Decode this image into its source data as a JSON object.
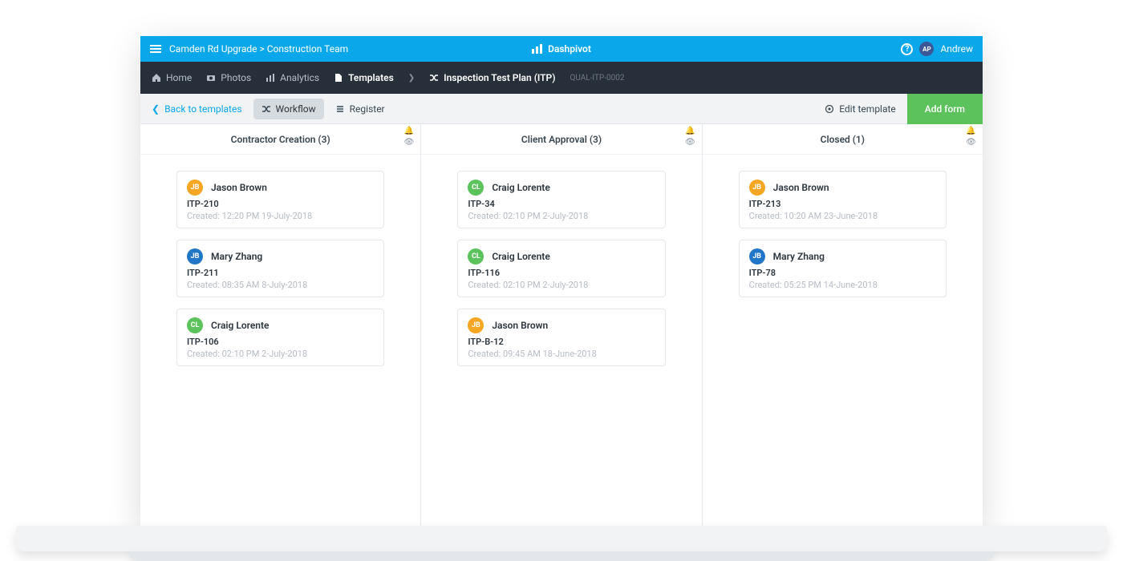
{
  "app": {
    "name": "Dashpivot"
  },
  "header": {
    "breadcrumb": "Camden Rd Upgrade > Construction Team",
    "user": {
      "initials": "AP",
      "name": "Andrew"
    }
  },
  "nav": {
    "home": "Home",
    "photos": "Photos",
    "analytics": "Analytics",
    "templates": "Templates",
    "template_name": "Inspection Test Plan (ITP)",
    "template_code": "QUAL-ITP-0002"
  },
  "toolbar": {
    "back": "Back to templates",
    "workflow": "Workflow",
    "register": "Register",
    "edit": "Edit template",
    "add": "Add form"
  },
  "colors": {
    "jb_orange": "#f5a623",
    "jb_blue": "#2176c7",
    "cl_green": "#5cc25c"
  },
  "columns": [
    {
      "title": "Contractor Creation (3)",
      "cards": [
        {
          "initials": "JB",
          "color": "jb_orange",
          "name": "Jason Brown",
          "ref": "ITP-210",
          "meta": "Created: 12:20 PM 19-July-2018"
        },
        {
          "initials": "JB",
          "color": "jb_blue",
          "name": "Mary Zhang",
          "ref": "ITP-211",
          "meta": "Created: 08:35 AM 8-July-2018"
        },
        {
          "initials": "CL",
          "color": "cl_green",
          "name": "Craig Lorente",
          "ref": "ITP-106",
          "meta": "Created: 02:10 PM 2-July-2018"
        }
      ]
    },
    {
      "title": "Client Approval (3)",
      "cards": [
        {
          "initials": "CL",
          "color": "cl_green",
          "name": "Craig Lorente",
          "ref": "ITP-34",
          "meta": "Created: 02:10 PM 2-July-2018"
        },
        {
          "initials": "CL",
          "color": "cl_green",
          "name": "Craig Lorente",
          "ref": "ITP-116",
          "meta": "Created: 02:10 PM 2-July-2018"
        },
        {
          "initials": "JB",
          "color": "jb_orange",
          "name": "Jason Brown",
          "ref": "ITP-B-12",
          "meta": "Created: 09:45 AM 18-June-2018"
        }
      ]
    },
    {
      "title": "Closed (1)",
      "cards": [
        {
          "initials": "JB",
          "color": "jb_orange",
          "name": "Jason Brown",
          "ref": "ITP-213",
          "meta": "Created: 10:20 AM 23-June-2018"
        },
        {
          "initials": "JB",
          "color": "jb_blue",
          "name": "Mary Zhang",
          "ref": "ITP-78",
          "meta": "Created: 05:25 PM 14-June-2018"
        }
      ]
    }
  ]
}
